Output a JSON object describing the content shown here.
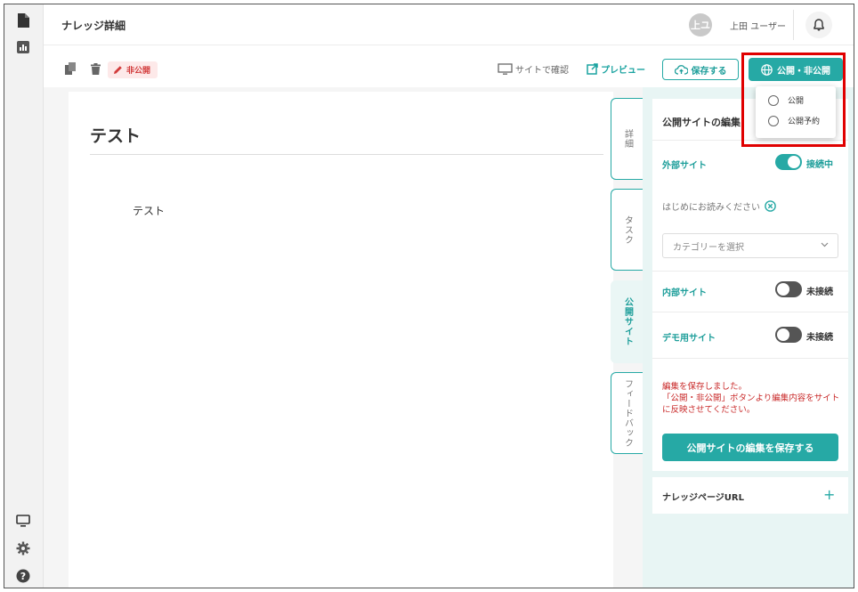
{
  "header": {
    "title": "ナレッジ詳細",
    "avatar_initials": "上ユ",
    "user_name": "上田 ユーザー"
  },
  "toolbar": {
    "status_label": "非公開",
    "site_check_label": "サイトで確認",
    "preview_label": "プレビュー",
    "save_label": "保存する",
    "publish_label": "公開・非公開"
  },
  "publish_menu": {
    "options": [
      {
        "label": "公開",
        "selected": false
      },
      {
        "label": "公開予約",
        "selected": false
      }
    ]
  },
  "editor": {
    "title": "テスト",
    "body": "テスト"
  },
  "vertical_tabs": [
    {
      "label": "詳細",
      "active": false
    },
    {
      "label": "タスク",
      "active": false
    },
    {
      "label": "公開サイト",
      "active": true
    },
    {
      "label": "フィードバック",
      "active": false
    }
  ],
  "panel": {
    "title": "公開サイトの編集",
    "external_site": {
      "label": "外部サイト",
      "status": "接続中",
      "on": true
    },
    "intro_link": "はじめにお読みください",
    "category_placeholder": "カテゴリーを選択",
    "internal_site": {
      "label": "内部サイト",
      "status": "未接続",
      "on": false
    },
    "demo_site": {
      "label": "デモ用サイト",
      "status": "未接続",
      "on": false
    },
    "save_message_line1": "編集を保存しました。",
    "save_message_line2": "「公開・非公開」ボタンより編集内容をサイトに反映させてください。",
    "save_button": "公開サイトの編集を保存する",
    "url_section_title": "ナレッジページURL"
  },
  "colors": {
    "accent": "#26a9a5",
    "danger": "#d23b3b",
    "panel_bg": "#e8f5f4"
  }
}
